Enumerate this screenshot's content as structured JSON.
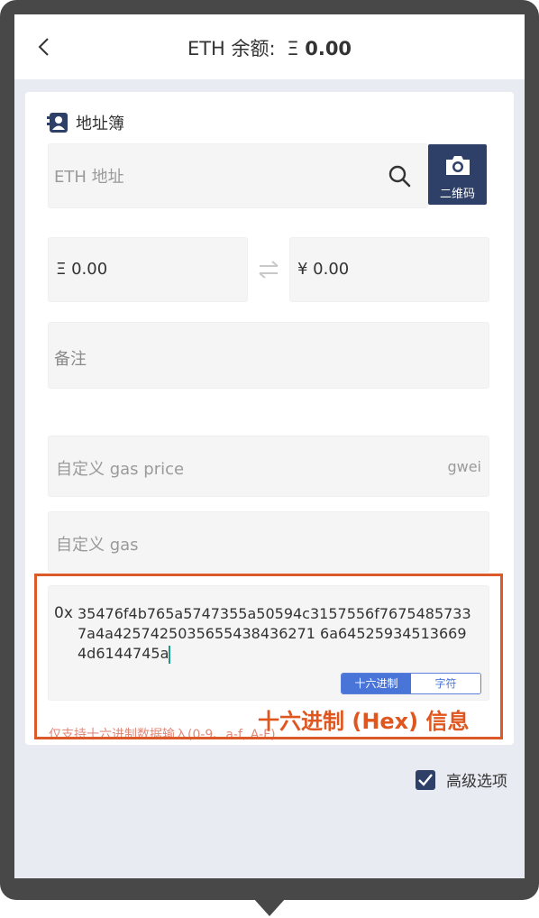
{
  "header": {
    "title": "ETH 余额:",
    "currency_symbol": "Ξ",
    "balance": "0.00"
  },
  "address_book": {
    "label": "地址簿",
    "icon": "contact-book-icon"
  },
  "address": {
    "placeholder": "ETH 地址",
    "search_icon": "search-icon"
  },
  "qr_button": {
    "label": "二维码",
    "icon": "camera-icon"
  },
  "amount": {
    "eth": "Ξ 0.00",
    "cny": "¥ 0.00",
    "swap_icon": "swap-arrows-icon"
  },
  "memo": {
    "placeholder": "备注"
  },
  "gas_price": {
    "placeholder": "自定义 gas price",
    "unit": "gwei"
  },
  "gas": {
    "placeholder": "自定义 gas"
  },
  "hex_data": {
    "prefix": "0x",
    "value": "35476f4b765a5747355a50594c3157556f76754857337a4a4257425035655438436271 6a645259345136694d6144745a"
  },
  "mode_toggle": {
    "hex": "十六进制",
    "text": "字符",
    "selected": "hex"
  },
  "hint": "仅支持十六进制数据输入(0-9、a-f, A-F)",
  "annotation": "十六进制 (Hex) 信息",
  "advanced": {
    "label": "高级选项",
    "checked": true
  },
  "colors": {
    "accent": "#2f4068",
    "toggle": "#4a75d8",
    "annotation": "#dc5a2a"
  }
}
